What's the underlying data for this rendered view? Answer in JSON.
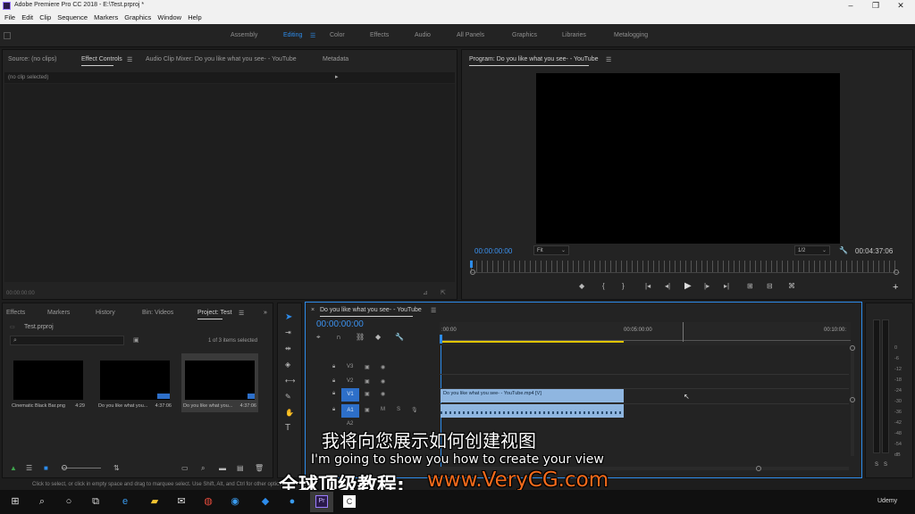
{
  "window": {
    "title": "Adobe Premiere Pro CC 2018 - E:\\Test.prproj *"
  },
  "menu": [
    "File",
    "Edit",
    "Clip",
    "Sequence",
    "Markers",
    "Graphics",
    "Window",
    "Help"
  ],
  "workspaces": [
    "Assembly",
    "Editing",
    "Color",
    "Effects",
    "Audio",
    "All Panels",
    "Graphics",
    "Libraries",
    "Metalogging"
  ],
  "active_workspace": "Editing",
  "source_panel": {
    "tabs": [
      "Source: (no clips)",
      "Effect Controls",
      "Audio Clip Mixer: Do you like what you see- - YouTube",
      "Metadata"
    ],
    "no_clip": "(no clip selected)",
    "timecode": "00:00:00:00"
  },
  "program_monitor": {
    "title": "Program: Do you like what you see- - YouTube",
    "timecode": "00:00:00:00",
    "fit": "Fit",
    "resolution": "1/2",
    "duration": "00:04:37:06"
  },
  "project_panel": {
    "tabs": [
      "Effects",
      "Markers",
      "History",
      "Bin: Videos",
      "Project: Test"
    ],
    "project_file": "Test.prproj",
    "items_count": "1 of 3 items selected",
    "items": [
      {
        "name": "Cinematic Black Bar.png",
        "duration": "4:29"
      },
      {
        "name": "Do you like what you...",
        "duration": "4:37:06"
      },
      {
        "name": "Do you like what you...",
        "duration": "4:37:06"
      }
    ]
  },
  "timeline": {
    "title": "Do you like what you see- - YouTube",
    "timecode": "00:00:00:00",
    "ruler": [
      ":00:00",
      "00:05:00:00",
      "00:10:00:"
    ],
    "tracks": [
      "V3",
      "V2",
      "V1",
      "A1",
      "A2"
    ],
    "clip_label": "Do you like what you see- - YouTube.mp4 [V]"
  },
  "audio_meter": {
    "scale": [
      "0",
      "-6",
      "-12",
      "-18",
      "-24",
      "-30",
      "-36",
      "-42",
      "-48",
      "-54",
      "dB"
    ],
    "buttons": [
      "S",
      "S"
    ]
  },
  "status_bar": "Click to select, or click in empty space and drag to marquee select. Use Shift, Alt, and Ctrl for other options.",
  "subtitles": {
    "chinese": "我将向您展示如何创建视图",
    "english": "I'm going to show you how to create your view",
    "watermark_label": "全球顶级教程:",
    "watermark_url": "www.VeryCG.com"
  },
  "taskbar": {
    "udemy": "Udemy"
  },
  "colors": {
    "accent": "#2d8ceb",
    "clip": "#8fb6e0",
    "watermark": "#f26a1b",
    "playhead_bar": "#e0c400"
  }
}
